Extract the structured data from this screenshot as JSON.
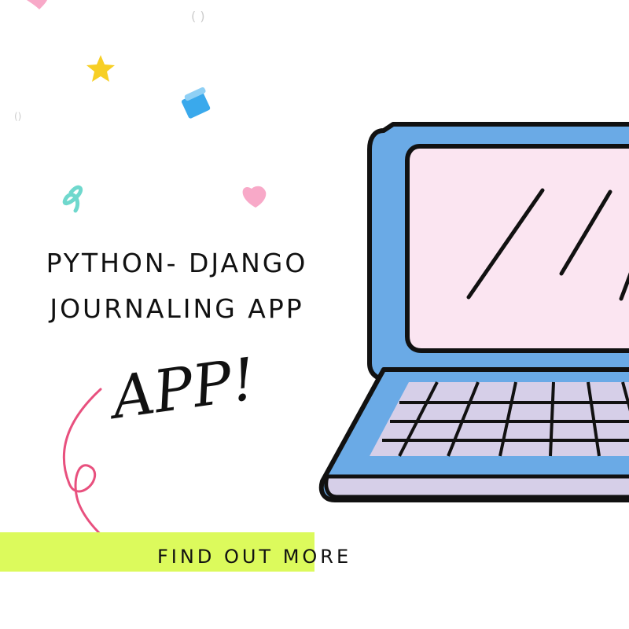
{
  "headline": {
    "line1": "PYTHON- DJANGO",
    "line2": "JOURNALING APP"
  },
  "script_word": "APP!",
  "cta": {
    "label": "FIND OUT MORE"
  },
  "colors": {
    "cta_highlight": "#dcfa5c",
    "laptop_body": "#6aaae6",
    "laptop_screen": "#fbe5f1",
    "keyboard": "#d6cfe8",
    "arrow": "#e8507e",
    "star": "#f7cf25",
    "heart": "#f8a9c8",
    "confetti_blue": "#3aa9ec",
    "squiggle": "#6fd8cd"
  },
  "icons": [
    "star-icon",
    "heart-icon",
    "confetti-icon",
    "squiggle-icon",
    "arrow-icon",
    "laptop-illustration"
  ]
}
